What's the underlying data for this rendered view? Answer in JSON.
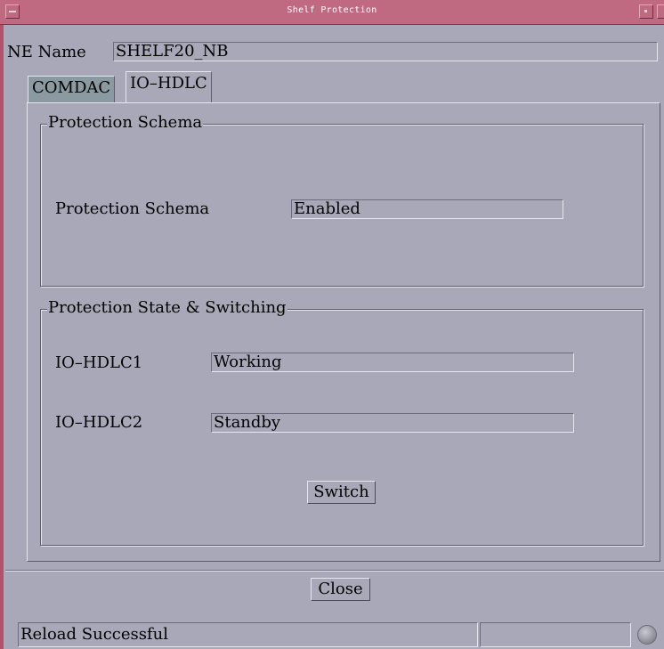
{
  "window": {
    "title": "Shelf Protection"
  },
  "ne": {
    "label": "NE Name",
    "value": "SHELF20_NB"
  },
  "tabs": [
    {
      "label": "COMDAC",
      "active": false
    },
    {
      "label": "IO–HDLC",
      "active": true
    }
  ],
  "schema_group": {
    "title": "Protection Schema",
    "row_label": "Protection Schema",
    "row_value": "Enabled"
  },
  "state_group": {
    "title": "Protection State & Switching",
    "rows": [
      {
        "label": "IO–HDLC1",
        "value": "Working"
      },
      {
        "label": "IO–HDLC2",
        "value": "Standby"
      }
    ],
    "switch_label": "Switch"
  },
  "footer": {
    "close_label": "Close"
  },
  "status": {
    "message": "Reload Successful",
    "cell2": "",
    "cell3": ""
  },
  "colors": {
    "titlebar": "#c06a82",
    "background": "#a8a8b8",
    "inactive_tab": "#8b9aa0"
  }
}
